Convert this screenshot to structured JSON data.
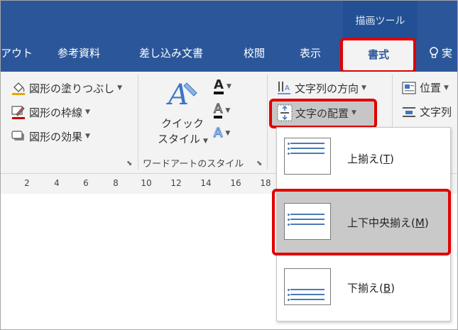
{
  "tabbar": {
    "context_header": "描画ツール",
    "tabs": [
      "アウト",
      "参考資料",
      "差し込み文書",
      "校閲",
      "表示"
    ],
    "active_tab": "書式",
    "partial_tab": "実"
  },
  "ribbon": {
    "shape_group": {
      "fill": "図形の塗りつぶし",
      "outline": "図形の枠線",
      "effects": "図形の効果"
    },
    "wordart_group": {
      "quick_style_line1": "クイック",
      "quick_style_line2": "スタイル",
      "group_label": "ワードアートのスタイル"
    },
    "text_group": {
      "direction": "文字列の方向",
      "align": "文字の配置"
    },
    "arrange_group": {
      "position": "位置",
      "wrap": "文字列"
    }
  },
  "ruler": {
    "ticks": [
      "2",
      "4",
      "6",
      "8",
      "10",
      "12",
      "14",
      "16",
      "18"
    ]
  },
  "dropdown": {
    "options": [
      {
        "label": "上揃え(",
        "key": "T",
        "suffix": ")"
      },
      {
        "label": "上下中央揃え(",
        "key": "M",
        "suffix": ")"
      },
      {
        "label": "下揃え(",
        "key": "B",
        "suffix": ")"
      }
    ]
  },
  "colors": {
    "ribbon_blue": "#2b579a",
    "highlight_red": "#e00000",
    "selected_gray": "#c9c9c9"
  }
}
